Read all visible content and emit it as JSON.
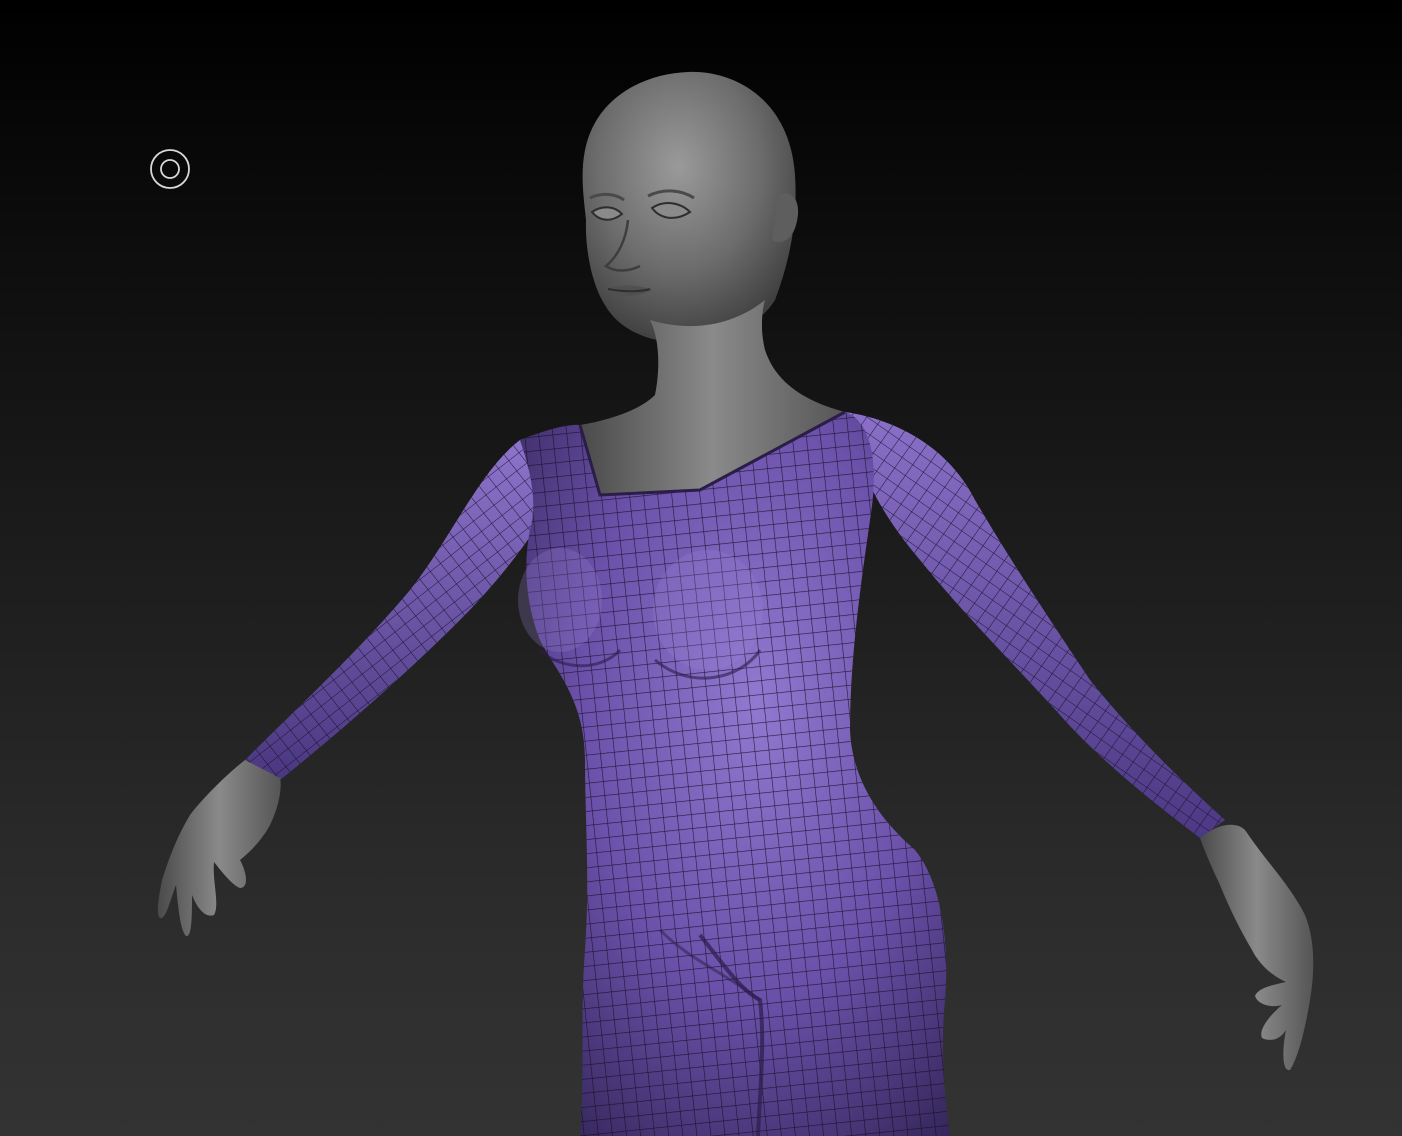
{
  "viewport": {
    "background_top": "#000000",
    "background_bottom": "#333333"
  },
  "model": {
    "skin_color": "#6c6c6c",
    "skin_highlight": "#9a9a9a",
    "skin_shadow": "#3a3a3a",
    "suit_color": "#6a50a8",
    "suit_highlight": "#9279d0",
    "suit_shadow": "#34265a",
    "wireframe_color": "#140c22"
  },
  "cursor": {
    "icon": "brush-cursor-icon",
    "color": "#d8d8d8"
  }
}
